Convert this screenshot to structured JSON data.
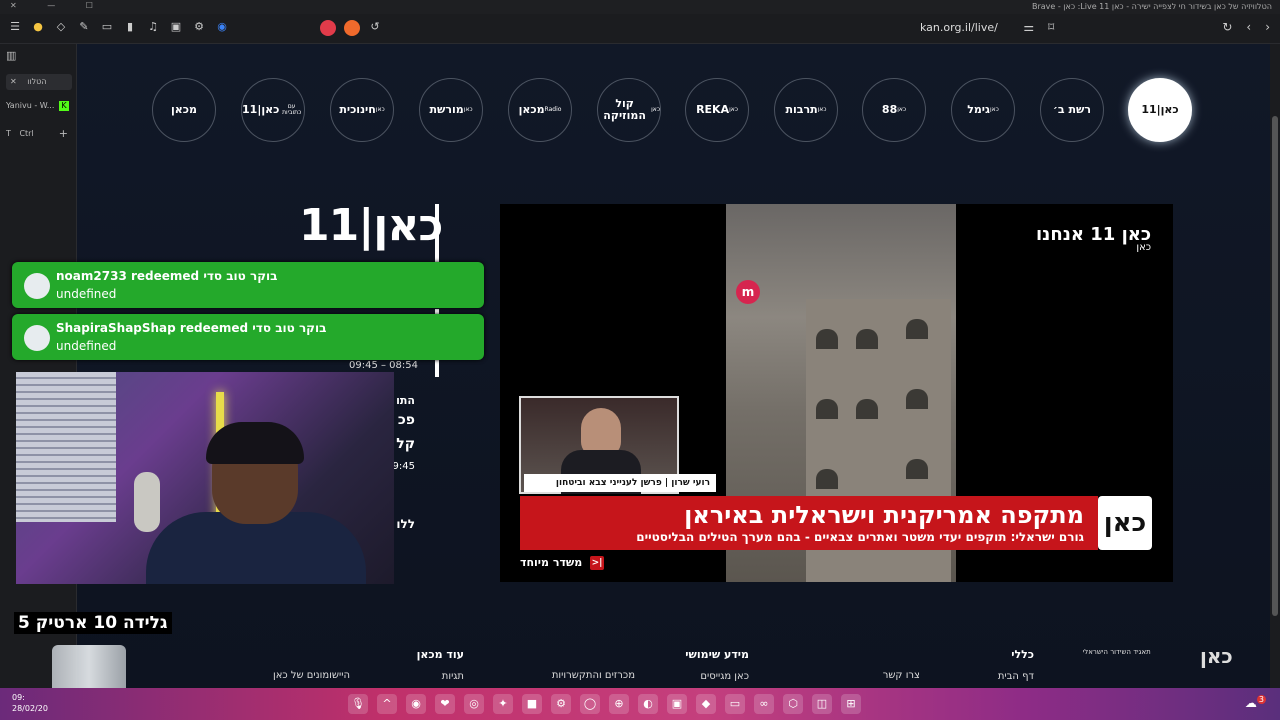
{
  "window": {
    "title": "הטלוויזיה של כאן בשידור חי לצפייה ישירה - כאן 11 Live: כאן - Brave",
    "controls": "✕ — ☐"
  },
  "toolbar": {
    "url": "kan.org.il/live/",
    "icons": [
      "menu-icon",
      "brave-icon",
      "shield-icon",
      "pen-icon",
      "wallet-icon",
      "sidebar-icon",
      "music-icon",
      "screenshot-icon",
      "extensions-icon",
      "audio-icon"
    ]
  },
  "sidebar": {
    "tab1": "הטלוו",
    "tab2": "Yanivu - W...",
    "ctrl_label": "Ctrl",
    "ctrl_t": "T",
    "add": "+"
  },
  "channels": [
    {
      "label": "כאן|11",
      "sub": "",
      "active": true
    },
    {
      "label": "רשת ב׳",
      "sub": "",
      "active": false
    },
    {
      "label": "גימל",
      "sub": "כאן",
      "active": false
    },
    {
      "label": "88",
      "sub": "כאן",
      "active": false
    },
    {
      "label": "תרבות",
      "sub": "כאן",
      "active": false
    },
    {
      "label": "REKA",
      "sub": "כאן",
      "active": false
    },
    {
      "label": "קול המוזיקה",
      "sub": "כאן",
      "active": false
    },
    {
      "label": "מכאן",
      "sub": "Radio",
      "active": false
    },
    {
      "label": "מורשת",
      "sub": "כאן",
      "active": false
    },
    {
      "label": "חינוכית",
      "sub": "כאן",
      "active": false
    },
    {
      "label": "כאן|11",
      "sub": "עם כתוביות",
      "active": false
    },
    {
      "label": "מכאן",
      "sub": "",
      "active": false
    }
  ],
  "brand": {
    "big_logo": "כאן|11"
  },
  "schedule": {
    "time": "09:45 – 08:54",
    "lines": [
      "התו",
      "פכ",
      "קל",
      "9:45",
      "ללו"
    ]
  },
  "video": {
    "overlay_top": "כאן 11 אנחנו",
    "overlay_sub": "כאן",
    "m_logo": "m",
    "pip_caption": "רועי שרון | פרשן לענייני צבא וביטחון",
    "headline": "מתקפה אמריקנית וישראלית באיראן",
    "subline": "גורם ישראלי: תוקפים יעדי משטר ואתרים צבאיים - בהם מערך הטילים הבליסטיים",
    "banner_logo": "כאן",
    "special": "משדר מיוחד",
    "special_icon": "|<"
  },
  "alerts": [
    {
      "user": "noam2733",
      "text": "noam2733 redeemed בוקר טוב סדי",
      "sub": "undefined"
    },
    {
      "user": "ShapiraShapShap",
      "text": "ShapiraShapShap redeemed בוקר טוב סדי",
      "sub": "undefined"
    }
  ],
  "flavor": "גלידה 10 ארטיק 5",
  "footer": {
    "logo": "כאן",
    "logo_sub": "תאגיד השידור הישראלי",
    "cols": [
      {
        "head": "כללי",
        "item": "דף הבית"
      },
      {
        "head": "",
        "item": "צרו קשר"
      },
      {
        "head": "מידע שימושי",
        "item": "כאן מגייסים"
      },
      {
        "head": "",
        "item": "מכרזים והתקשרויות"
      },
      {
        "head": "עוד מכאן",
        "item": "תגיות"
      },
      {
        "head": "",
        "item": "היישומונים של כאן"
      }
    ]
  },
  "taskbar": {
    "time": "09:",
    "date": "28/02/20",
    "weather_badge": "3",
    "icons": [
      "🎙",
      "^",
      "◉",
      "❤",
      "◎",
      "✦",
      "■",
      "⚙",
      "◯",
      "⊕",
      "◐",
      "▣",
      "◆",
      "▭",
      "∞",
      "⬡",
      "◫",
      "⊞"
    ]
  },
  "colors": {
    "banner_red": "#c6151b",
    "alert_green": "#24a92b",
    "accent_bg": "#0f1623"
  }
}
